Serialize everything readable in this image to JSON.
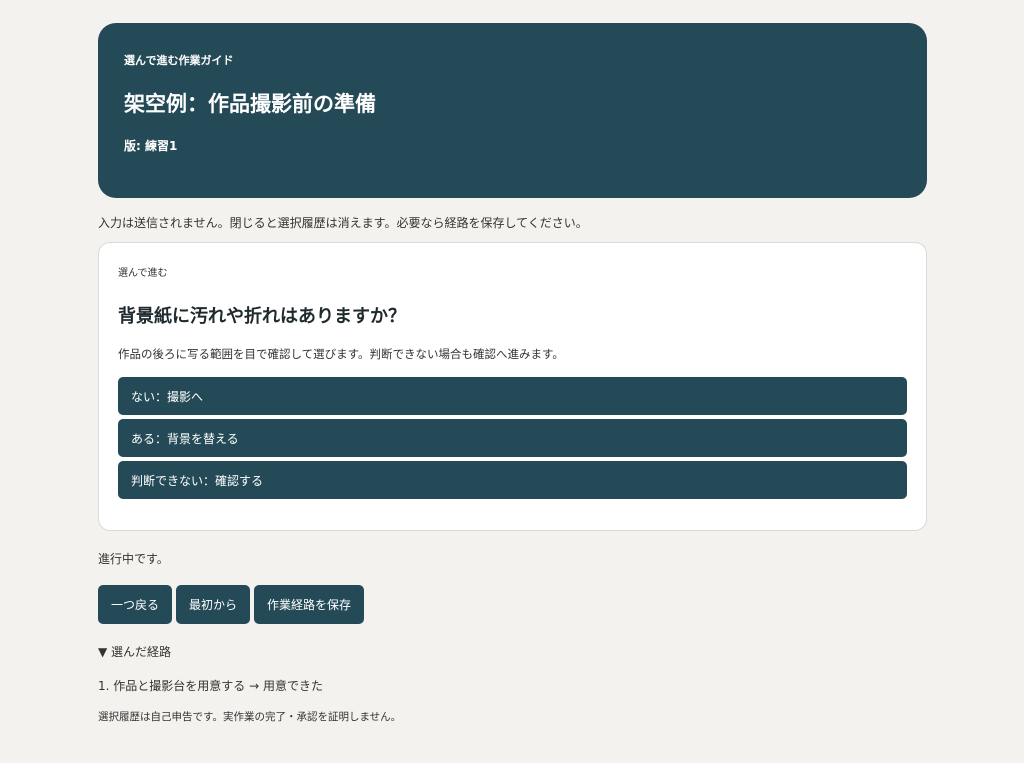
{
  "header": {
    "eyebrow": "選んで進む作業ガイド",
    "title": "架空例：作品撮影前の準備",
    "version": "版: 練習1"
  },
  "notice": "入力は送信されません。閉じると選択履歴は消えます。必要なら経路を保存してください。",
  "card": {
    "eyebrow": "選んで進む",
    "question": "背景紙に汚れや折れはありますか？",
    "description": "作品の後ろに写る範囲を目で確認して選びます。判断できない場合も確認へ進みます。",
    "choices": [
      {
        "label": "ない：撮影へ"
      },
      {
        "label": "ある：背景を替える"
      },
      {
        "label": "判断できない：確認する"
      }
    ]
  },
  "status": "進行中です。",
  "actions": {
    "back_label": "一つ戻る",
    "restart_label": "最初から",
    "save_label": "作業経路を保存"
  },
  "path": {
    "summary": "▼ 選んだ経路",
    "items": [
      "1. 作品と撮影台を用意する → 用意できた"
    ]
  },
  "disclaimer": "選択履歴は自己申告です。実作業の完了・承認を証明しません。",
  "colors": {
    "primary": "#244a57",
    "background": "#f4f2ee",
    "card": "#ffffff"
  }
}
